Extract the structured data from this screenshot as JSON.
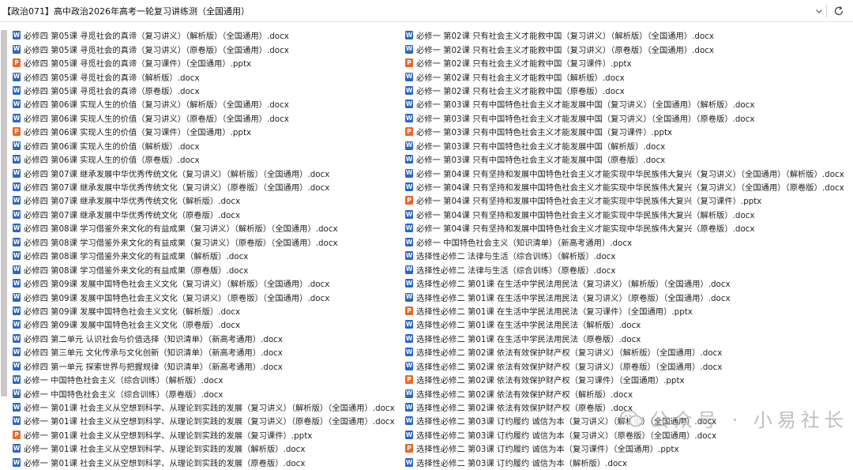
{
  "address_bar": {
    "path": "【政治071】高中政治2026年高考一轮复习讲练测（全国通用）",
    "dropdown_icon": "chevron-down-icon",
    "refresh_icon": "refresh-icon"
  },
  "colors": {
    "docx_icon": "#2b66c4",
    "pptx_icon": "#e9672b"
  },
  "left_files": [
    {
      "name": "必修四 第05课 寻觅社会的真谛（复习讲义）（解析版）（全国通用）.docx",
      "type": "docx"
    },
    {
      "name": "必修四 第05课 寻觅社会的真谛（复习讲义）（原卷版）（全国通用）.docx",
      "type": "docx"
    },
    {
      "name": "必修四 第05课 寻觅社会的真谛（复习课件）（全国通用）.pptx",
      "type": "pptx"
    },
    {
      "name": "必修四 第05课 寻觅社会的真谛（解析版）.docx",
      "type": "docx"
    },
    {
      "name": "必修四 第05课 寻觅社会的真谛（原卷版）.docx",
      "type": "docx"
    },
    {
      "name": "必修四 第06课 实现人生的价值（复习讲义）（解析版）（全国通用）.docx",
      "type": "docx"
    },
    {
      "name": "必修四 第06课 实现人生的价值（复习讲义）（原卷版）（全国通用）.docx",
      "type": "docx"
    },
    {
      "name": "必修四 第06课 实现人生的价值（复习课件）（全国通用）.pptx",
      "type": "pptx"
    },
    {
      "name": "必修四 第06课 实现人生的价值（解析版）.docx",
      "type": "docx"
    },
    {
      "name": "必修四 第06课 实现人生的价值（原卷版）.docx",
      "type": "docx"
    },
    {
      "name": "必修四 第07课 继承发展中华优秀传统文化（复习讲义）（解析版）（全国通用）.docx",
      "type": "docx"
    },
    {
      "name": "必修四 第07课 继承发展中华优秀传统文化（复习讲义）（原卷版）（全国通用）.docx",
      "type": "docx"
    },
    {
      "name": "必修四 第07课 继承发展中华优秀传统文化（解析版）.docx",
      "type": "docx"
    },
    {
      "name": "必修四 第07课 继承发展中华优秀传统文化（原卷版）.docx",
      "type": "docx"
    },
    {
      "name": "必修四 第08课 学习借鉴外来文化的有益成果（复习讲义）（解析版）（全国通用）.docx",
      "type": "docx"
    },
    {
      "name": "必修四 第08课 学习借鉴外来文化的有益成果（复习讲义）（原卷版）（全国通用）.docx",
      "type": "docx"
    },
    {
      "name": "必修四 第08课 学习借鉴外来文化的有益成果（解析版）.docx",
      "type": "docx"
    },
    {
      "name": "必修四 第08课 学习借鉴外来文化的有益成果（原卷版）.docx",
      "type": "docx"
    },
    {
      "name": "必修四 第09课 发展中国特色社会主义文化（复习讲义）（解析版）（全国通用）.docx",
      "type": "docx"
    },
    {
      "name": "必修四 第09课 发展中国特色社会主义文化（复习讲义）（原卷版）（全国通用）.docx",
      "type": "docx"
    },
    {
      "name": "必修四 第09课 发展中国特色社会主义文化（解析版）.docx",
      "type": "docx"
    },
    {
      "name": "必修四 第09课 发展中国特色社会主义文化（原卷版）.docx",
      "type": "docx"
    },
    {
      "name": "必修四 第二单元 认识社会与价值选择（知识清单）（新高考通用）.docx",
      "type": "docx"
    },
    {
      "name": "必修四 第三单元 文化传承与文化创新（知识清单）（新高考通用）.docx",
      "type": "docx"
    },
    {
      "name": "必修四 第一单元 探索世界与把握规律（知识清单）（新高考通用）.docx",
      "type": "docx"
    },
    {
      "name": "必修一 中国特色社会主义（综合训练）（解析版）.docx",
      "type": "docx"
    },
    {
      "name": "必修一 中国特色社会主义（综合训练）（原卷版）.docx",
      "type": "docx"
    },
    {
      "name": "必修一 第01课 社会主义从空想到科学、从理论到实践的发展（复习讲义）（解析版）（全国通用）.docx",
      "type": "docx"
    },
    {
      "name": "必修一 第01课 社会主义从空想到科学、从理论到实践的发展（复习讲义）（原卷版）（全国通用）.docx",
      "type": "docx"
    },
    {
      "name": "必修一 第01课 社会主义从空想到科学、从理论到实践的发展（复习课件）.pptx",
      "type": "pptx"
    },
    {
      "name": "必修一 第01课 社会主义从空想到科学、从理论到实践的发展（解析版）.docx",
      "type": "docx"
    },
    {
      "name": "必修一 第01课 社会主义从空想到科学、从理论到实践的发展（原卷版）.docx",
      "type": "docx"
    }
  ],
  "right_files": [
    {
      "name": "必修一 第02课 只有社会主义才能救中国（复习讲义）（解析版）（全国通用）.docx",
      "type": "docx"
    },
    {
      "name": "必修一 第02课 只有社会主义才能救中国（复习讲义）（原卷版）（全国通用）.docx",
      "type": "docx"
    },
    {
      "name": "必修一 第02课 只有社会主义才能救中国（复习课件）.pptx",
      "type": "pptx"
    },
    {
      "name": "必修一 第02课 只有社会主义才能救中国（解析版）.docx",
      "type": "docx"
    },
    {
      "name": "必修一 第02课 只有社会主义才能救中国（原卷版）.docx",
      "type": "docx"
    },
    {
      "name": "必修一 第03课 只有中国特色社会主义才能发展中国（复习讲义）（全国通用）（解析版）.docx",
      "type": "docx"
    },
    {
      "name": "必修一 第03课 只有中国特色社会主义才能发展中国（复习讲义）（全国通用）（原卷版）.docx",
      "type": "docx"
    },
    {
      "name": "必修一 第03课 只有中国特色社会主义才能发展中国（复习课件）.pptx",
      "type": "pptx"
    },
    {
      "name": "必修一 第03课 只有中国特色社会主义才能发展中国（解析版）.docx",
      "type": "docx"
    },
    {
      "name": "必修一 第03课 只有中国特色社会主义才能发展中国（原卷版）.docx",
      "type": "docx"
    },
    {
      "name": "必修一 第04课 只有坚持和发展中国特色社会主义才能实现中华民族伟大复兴（复习讲义）（全国通用）（解析版）.docx",
      "type": "docx"
    },
    {
      "name": "必修一 第04课 只有坚持和发展中国特色社会主义才能实现中华民族伟大复兴（复习讲义）（全国通用）（原卷版）.docx",
      "type": "docx"
    },
    {
      "name": "必修一 第04课 只有坚持和发展中国特色社会主义才能实现中华民族伟大复兴（复习课件）.pptx",
      "type": "pptx"
    },
    {
      "name": "必修一 第04课 只有坚持和发展中国特色社会主义才能实现中华民族伟大复兴（解析版）.docx",
      "type": "docx"
    },
    {
      "name": "必修一 第04课 只有坚持和发展中国特色社会主义才能实现中华民族伟大复兴（原卷版）.docx",
      "type": "docx"
    },
    {
      "name": "必修一 中国特色社会主义（知识清单）（新高考通用）.docx",
      "type": "docx"
    },
    {
      "name": "选择性必修二 法律与生活（综合训练）（解析版）.docx",
      "type": "docx"
    },
    {
      "name": "选择性必修二 法律与生活（综合训练）（原卷版）.docx",
      "type": "docx"
    },
    {
      "name": "选择性必修二 第01课 在生活中学民法用民法（复习讲义）（解析版）（全国通用）.docx",
      "type": "docx"
    },
    {
      "name": "选择性必修二 第01课 在生活中学民法用民法（复习讲义）（原卷版）（全国通用）.docx",
      "type": "docx"
    },
    {
      "name": "选择性必修二 第01课 在生活中学民法用民法（复习课件）（全国通用）.pptx",
      "type": "pptx"
    },
    {
      "name": "选择性必修二 第01课 在生活中学民法用民法（解析版）.docx",
      "type": "docx"
    },
    {
      "name": "选择性必修二 第01课 在生活中学民法用民法（原卷版）.docx",
      "type": "docx"
    },
    {
      "name": "选择性必修二 第02课 依法有效保护财产权（复习讲义）（解析版）（全国通用）.docx",
      "type": "docx"
    },
    {
      "name": "选择性必修二 第02课 依法有效保护财产权（复习讲义）（原卷版）（全国通用）.docx",
      "type": "docx"
    },
    {
      "name": "选择性必修二 第02课 依法有效保护财产权（复习课件）（全国通用）.pptx",
      "type": "pptx"
    },
    {
      "name": "选择性必修二 第02课 依法有效保护财产权（解析版）.docx",
      "type": "docx"
    },
    {
      "name": "选择性必修二 第02课 依法有效保护财产权（原卷版）.docx",
      "type": "docx"
    },
    {
      "name": "选择性必修二 第03课 订约履约 诚信为本（复习讲义）（解析版）（全国通用）.docx",
      "type": "docx"
    },
    {
      "name": "选择性必修二 第03课 订约履约 诚信为本（复习讲义）（原卷版）（全国通用）.docx",
      "type": "docx"
    },
    {
      "name": "选择性必修二 第03课 订约履约 诚信为本（复习课件）（全国通用）.pptx",
      "type": "pptx"
    },
    {
      "name": "选择性必修二 第03课 订约履约 诚信为本（解析版）.docx",
      "type": "docx"
    }
  ],
  "watermark": {
    "text": "公众号 · 小易社长",
    "logo_icon": "wechat-logo-icon"
  }
}
